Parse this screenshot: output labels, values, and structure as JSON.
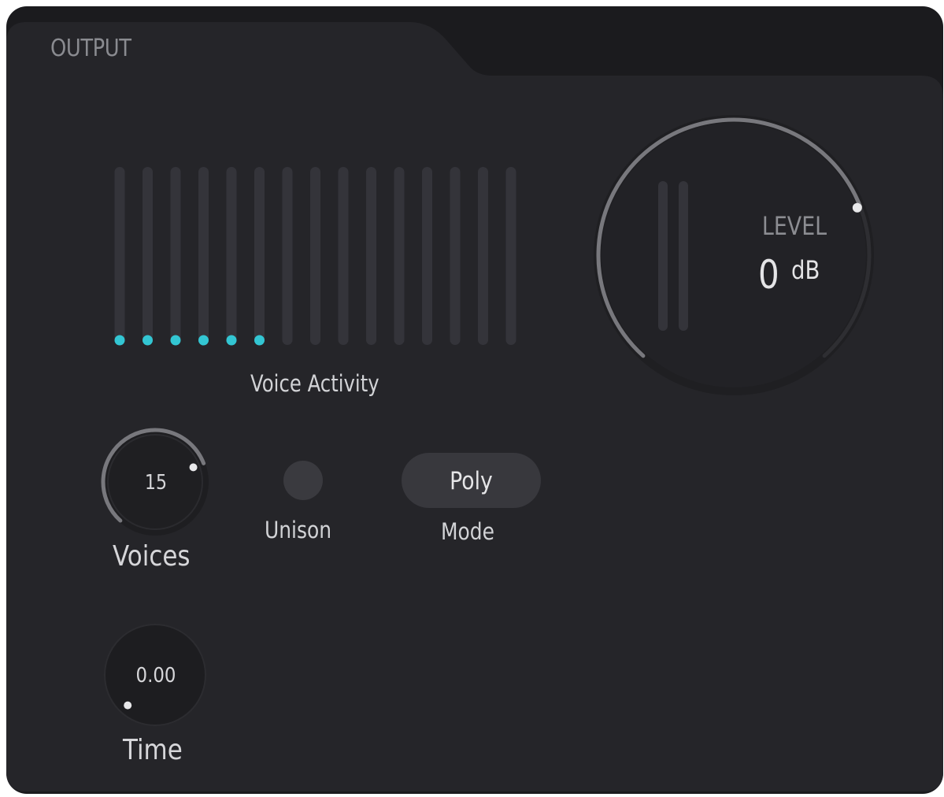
{
  "panel": {
    "title": "OUTPUT",
    "colors": {
      "panel_background": "#252529",
      "tab_strip": "#1c1c1f",
      "meter_track": "#34343a",
      "active_dot": "#33c6d3",
      "arc": "#78787d"
    }
  },
  "voice_activity": {
    "label": "Voice Activity",
    "total_voices": 15,
    "active_voices": 6
  },
  "voices_knob": {
    "label": "Voices",
    "value": "15",
    "level": 0.75
  },
  "unison": {
    "label": "Unison",
    "enabled": false
  },
  "mode": {
    "label": "Mode",
    "value": "Poly"
  },
  "time_knob": {
    "label": "Time",
    "value": "0.00",
    "level": 0.0
  },
  "level_knob": {
    "label": "LEVEL",
    "value": "0",
    "unit": "dB",
    "level": 0.75
  }
}
